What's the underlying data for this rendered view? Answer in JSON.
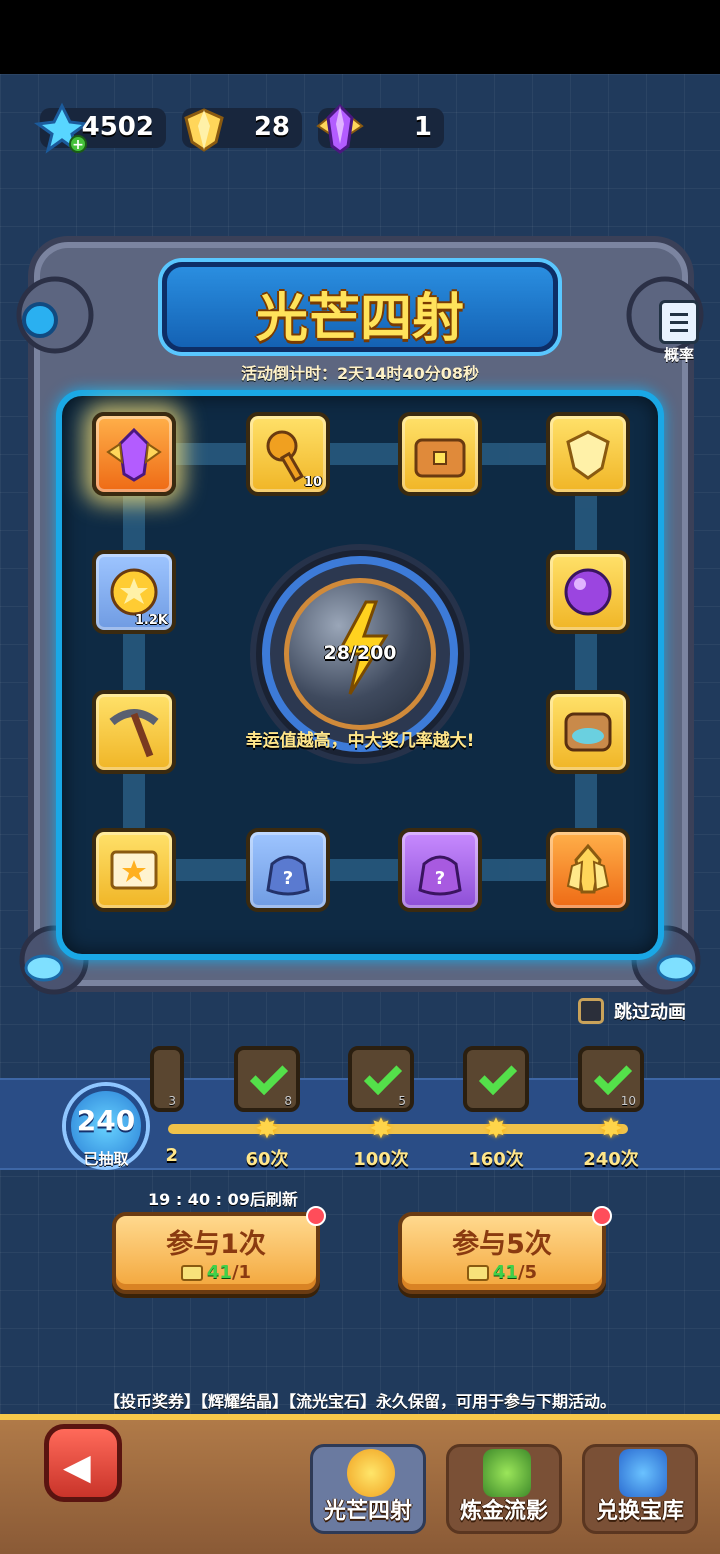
{
  "currencies": {
    "crystal": {
      "icon": "blue-crystal-icon",
      "value": "4502"
    },
    "gold_gem": {
      "icon": "gold-gem-icon",
      "value": "28"
    },
    "purple_gem": {
      "icon": "purple-gem-icon",
      "value": "1"
    }
  },
  "event": {
    "title": "光芒四射",
    "countdown": "活动倒计时：2天14时40分08秒",
    "probability_label": "概率"
  },
  "rewards": [
    {
      "icon": "purple-gem-icon",
      "qty": "",
      "bg": "orange",
      "highlight": true
    },
    {
      "icon": "key-icon",
      "qty": "10",
      "bg": "gold"
    },
    {
      "icon": "treasure-chest-icon",
      "qty": "",
      "bg": "gold"
    },
    {
      "icon": "gold-gem-icon",
      "qty": "",
      "bg": "gold"
    },
    {
      "icon": "gold-coin-icon",
      "qty": "1.2K",
      "bg": "blue"
    },
    {
      "icon": "purple-orb-icon",
      "qty": "",
      "bg": "gold"
    },
    {
      "icon": "pickaxe-icon",
      "qty": "",
      "bg": "gold"
    },
    {
      "icon": "scroll-bundle-icon",
      "qty": "",
      "bg": "gold"
    },
    {
      "icon": "ticket-scroll-icon",
      "qty": "",
      "bg": "gold"
    },
    {
      "icon": "mystery-bag-blue-icon",
      "qty": "",
      "bg": "blue"
    },
    {
      "icon": "mystery-bag-purple-icon",
      "qty": "",
      "bg": "purple"
    },
    {
      "icon": "gold-crystal-icon",
      "qty": "",
      "bg": "orange"
    }
  ],
  "luck": {
    "progress": "28/200",
    "hint": "幸运值越高，中大奖几率越大!"
  },
  "skip_animation": "跳过动画",
  "milestones": {
    "draw_count": "240",
    "draw_label": "已抽取",
    "items": [
      {
        "label": "60次",
        "qty": "8"
      },
      {
        "label": "100次",
        "qty": "5"
      },
      {
        "label": "160次",
        "qty": ""
      },
      {
        "label": "240次",
        "qty": "10"
      }
    ],
    "partial_qty": "3",
    "partial_label": "2"
  },
  "refresh": "19 : 40 : 09后刷新",
  "buttons": {
    "one": {
      "label": "参与1次",
      "have": "41",
      "cost": "/1"
    },
    "five": {
      "label": "参与5次",
      "have": "41",
      "cost": "/5"
    }
  },
  "note": "【投币奖券】【辉耀结晶】【流光宝石】永久保留，可用于参与下期活动。",
  "nav": {
    "tab1": "光芒四射",
    "tab2": "炼金流影",
    "tab3": "兑换宝库"
  }
}
